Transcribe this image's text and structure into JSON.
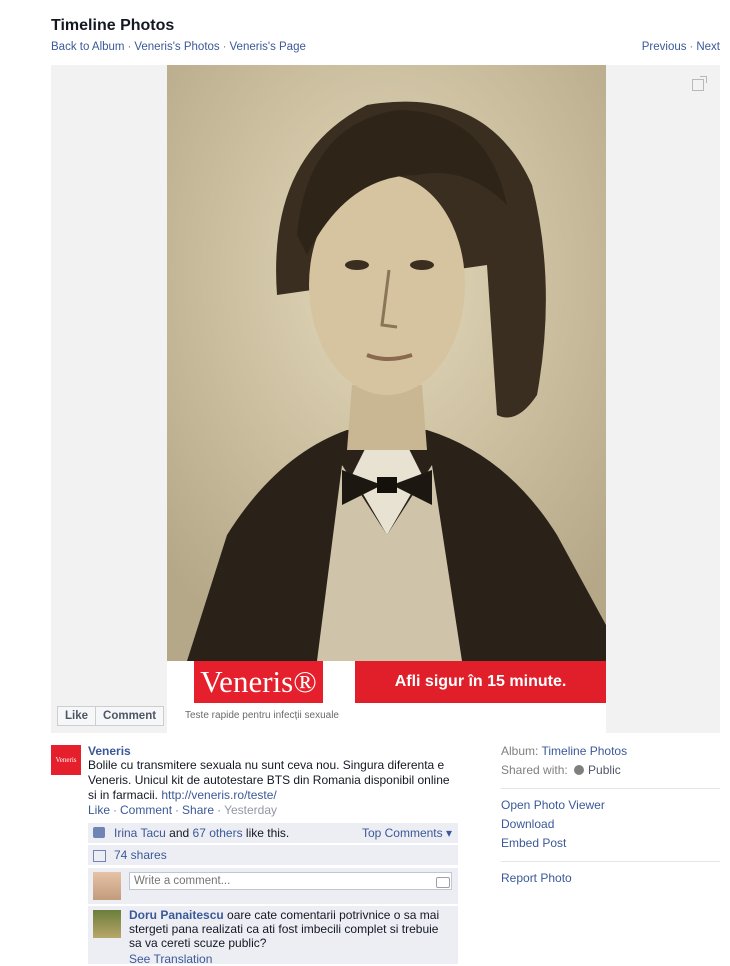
{
  "header": {
    "title": "Timeline Photos",
    "breadcrumbs": [
      "Back to Album",
      "Veneris's Photos",
      "Veneris's Page"
    ],
    "previous": "Previous",
    "next": "Next"
  },
  "photo": {
    "brand": "Veneris®",
    "slogan": "Afli sigur în 15 minute.",
    "tagline": "Teste rapide pentru infecții sexuale"
  },
  "photo_actions": {
    "like": "Like",
    "comment": "Comment"
  },
  "post": {
    "page_name": "Veneris",
    "avatar_text": "Veneris",
    "text": "Bolile cu transmitere sexuala nu sunt ceva nou. Singura diferenta e Veneris. Unicul kit de autotestare BTS din Romania disponibil online si in farmacii. ",
    "link": "http://veneris.ro/teste/",
    "actions": {
      "like": "Like",
      "comment": "Comment",
      "share": "Share",
      "time": "Yesterday"
    },
    "likes": {
      "person": "Irina Tacu",
      "and": "and",
      "others": "67 others",
      "suffix": "like this.",
      "top_comments": "Top Comments"
    },
    "shares": "74 shares",
    "comment_placeholder": "Write a comment...",
    "reply": {
      "author": "Doru Panaitescu",
      "text": "oare cate comentarii potrivnice o sa mai stergeti pana realizati ca ati fost imbecili complet si trebuie sa va cereti scuze public?",
      "see_translation": "See Translation"
    }
  },
  "sidebar": {
    "album_label": "Album:",
    "album_value": "Timeline Photos",
    "shared_label": "Shared with:",
    "shared_value": "Public",
    "links": [
      "Open Photo Viewer",
      "Download",
      "Embed Post"
    ],
    "report": "Report Photo"
  },
  "colors": {
    "link": "#3b5998",
    "brand_red": "#e51f2b",
    "ufi_bg": "#eceef4"
  },
  "icons": [
    "expand-icon",
    "thumb-icon",
    "shares-icon",
    "camera-icon",
    "globe-icon"
  ]
}
